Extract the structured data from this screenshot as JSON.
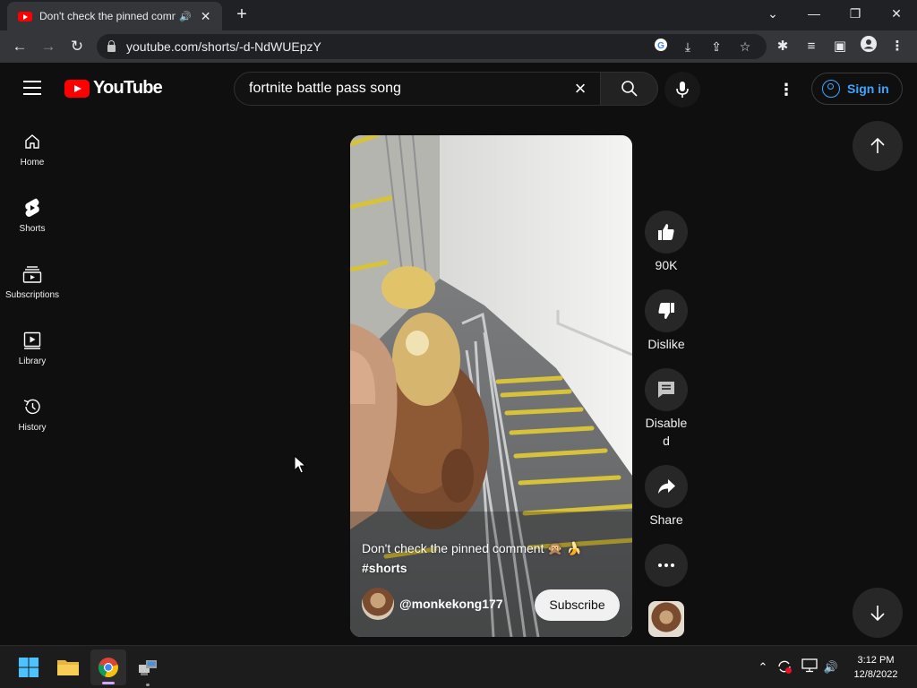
{
  "browser": {
    "tab_title": "Don't check the pinned comment",
    "new_tab": "+",
    "url": "youtube.com/shorts/-d-NdWUEpzY",
    "window_controls": {
      "minimize": "—",
      "restore": "❐",
      "close": "✕",
      "tab_search": "⌄"
    }
  },
  "youtube": {
    "logo_text": "YouTube",
    "search_value": "fortnite battle pass song",
    "sign_in": "Sign in"
  },
  "guide": [
    {
      "label": "Home",
      "icon": "home-icon"
    },
    {
      "label": "Shorts",
      "icon": "shorts-icon"
    },
    {
      "label": "Subscriptions",
      "icon": "subscriptions-icon"
    },
    {
      "label": "Library",
      "icon": "library-icon"
    },
    {
      "label": "History",
      "icon": "history-icon"
    }
  ],
  "short": {
    "title": "Don't check the pinned comment 🙊 🍌",
    "hashtag": "#shorts",
    "channel": "@monkekong177",
    "subscribe": "Subscribe"
  },
  "actions": {
    "likes": "90K",
    "dislike": "Dislike",
    "comments": "Disable\nd",
    "share": "Share"
  },
  "taskbar": {
    "time": "3:12 PM",
    "date": "12/8/2022"
  },
  "colors": {
    "youtube_red": "#ff0000",
    "link_blue": "#3ea6ff",
    "background": "#0f0f0f"
  }
}
